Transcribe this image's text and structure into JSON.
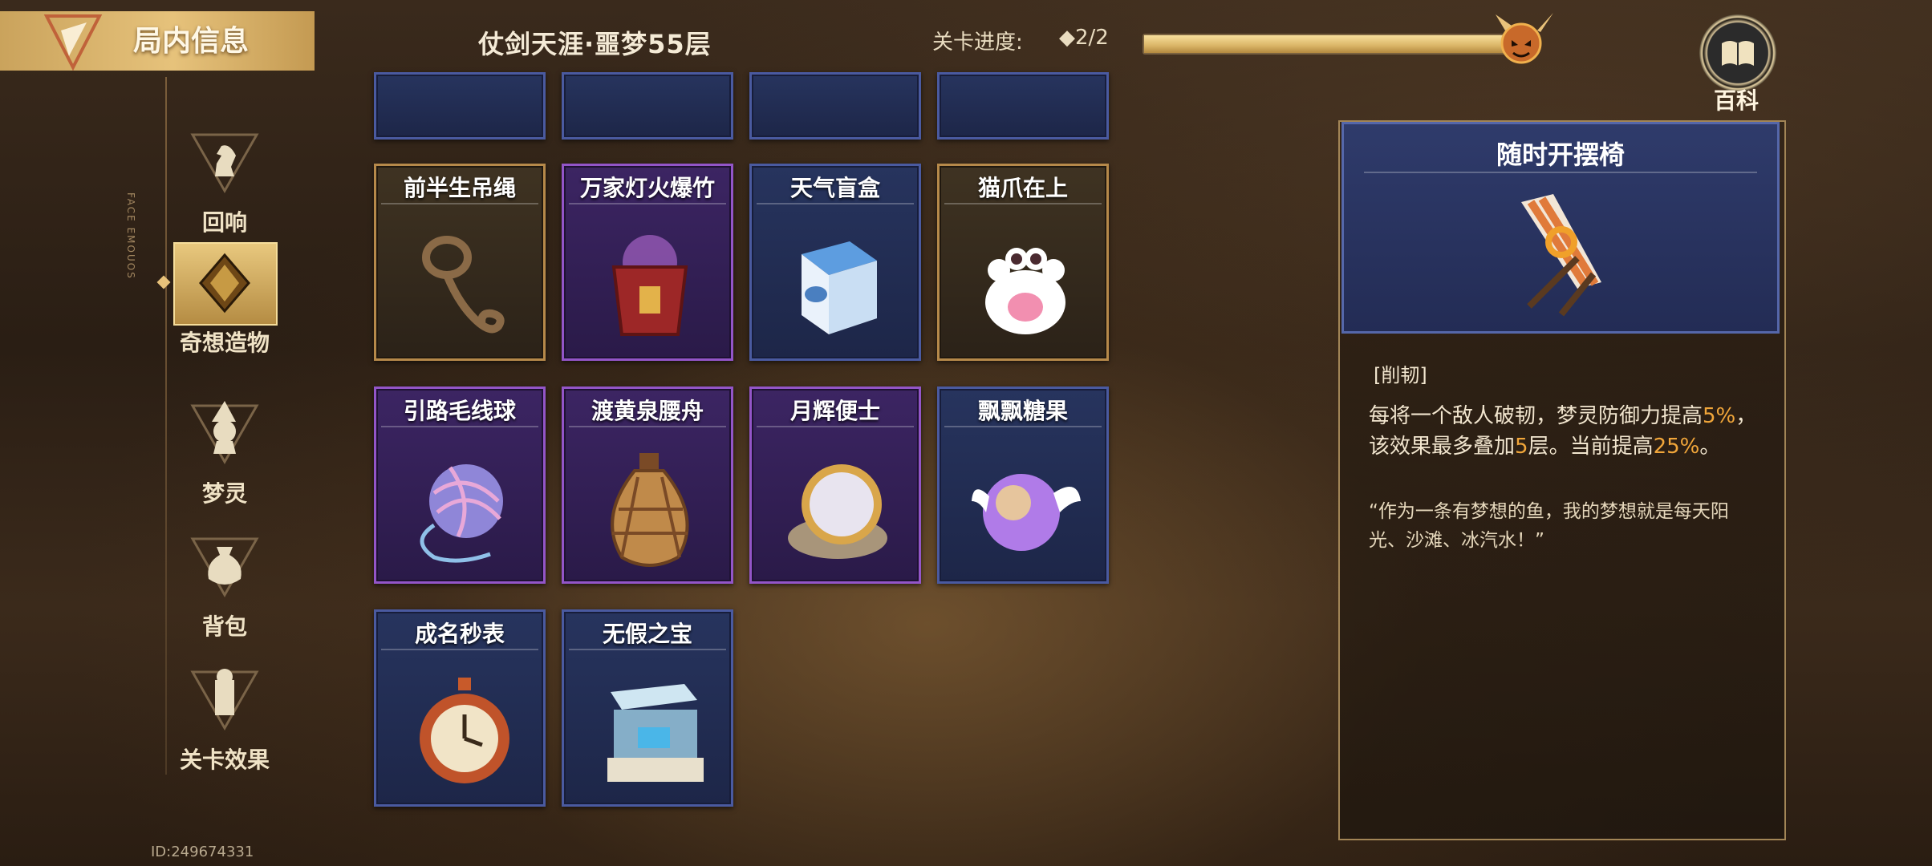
{
  "header": {
    "panel_title": "局内信息",
    "stage_title": "仗剑天涯·噩梦55层",
    "progress_label": "关卡进度:",
    "progress_value": "◆2/2",
    "progress_fraction": 1.0,
    "wiki_label": "百科"
  },
  "sidebar": {
    "items": [
      {
        "label": "回响",
        "icon": "chess-knight-icon"
      },
      {
        "label": "奇想造物",
        "icon": "crystal-icon",
        "selected": true
      },
      {
        "label": "梦灵",
        "icon": "witch-icon"
      },
      {
        "label": "背包",
        "icon": "bag-icon"
      },
      {
        "label": "关卡效果",
        "icon": "effect-icon"
      }
    ]
  },
  "uid": "ID:249674331",
  "items": [
    {
      "name": "前半生吊绳",
      "rarity": "gold",
      "icon": "rope-icon"
    },
    {
      "name": "万家灯火爆竹",
      "rarity": "purple",
      "icon": "firecracker-icon"
    },
    {
      "name": "天气盲盒",
      "rarity": "blue",
      "icon": "weather-box-icon"
    },
    {
      "name": "猫爪在上",
      "rarity": "gold",
      "icon": "cat-paw-icon"
    },
    {
      "name": "引路毛线球",
      "rarity": "purple",
      "icon": "yarn-ball-icon"
    },
    {
      "name": "渡黄泉腰舟",
      "rarity": "purple",
      "icon": "gourd-icon"
    },
    {
      "name": "月辉便士",
      "rarity": "purple",
      "icon": "coin-icon"
    },
    {
      "name": "飘飘糖果",
      "rarity": "blue",
      "icon": "winged-orb-icon"
    },
    {
      "name": "成名秒表",
      "rarity": "blue",
      "icon": "stopwatch-icon"
    },
    {
      "name": "无假之宝",
      "rarity": "blue",
      "icon": "display-case-icon"
    }
  ],
  "detail": {
    "title": "随时开摆椅",
    "tag": "[削韧]",
    "desc_part1": "每将一个敌人破韧，梦灵防御力提高",
    "desc_hl1": "5%",
    "desc_part2": "，该效果最多叠加",
    "desc_hl2": "5",
    "desc_part3": "层。当前提高",
    "desc_hl3": "25%",
    "desc_part4": "。",
    "quote": "“作为一条有梦想的鱼，我的梦想就是每天阳光、沙滩、冰汽水！”",
    "icon": "beach-chair-icon"
  }
}
